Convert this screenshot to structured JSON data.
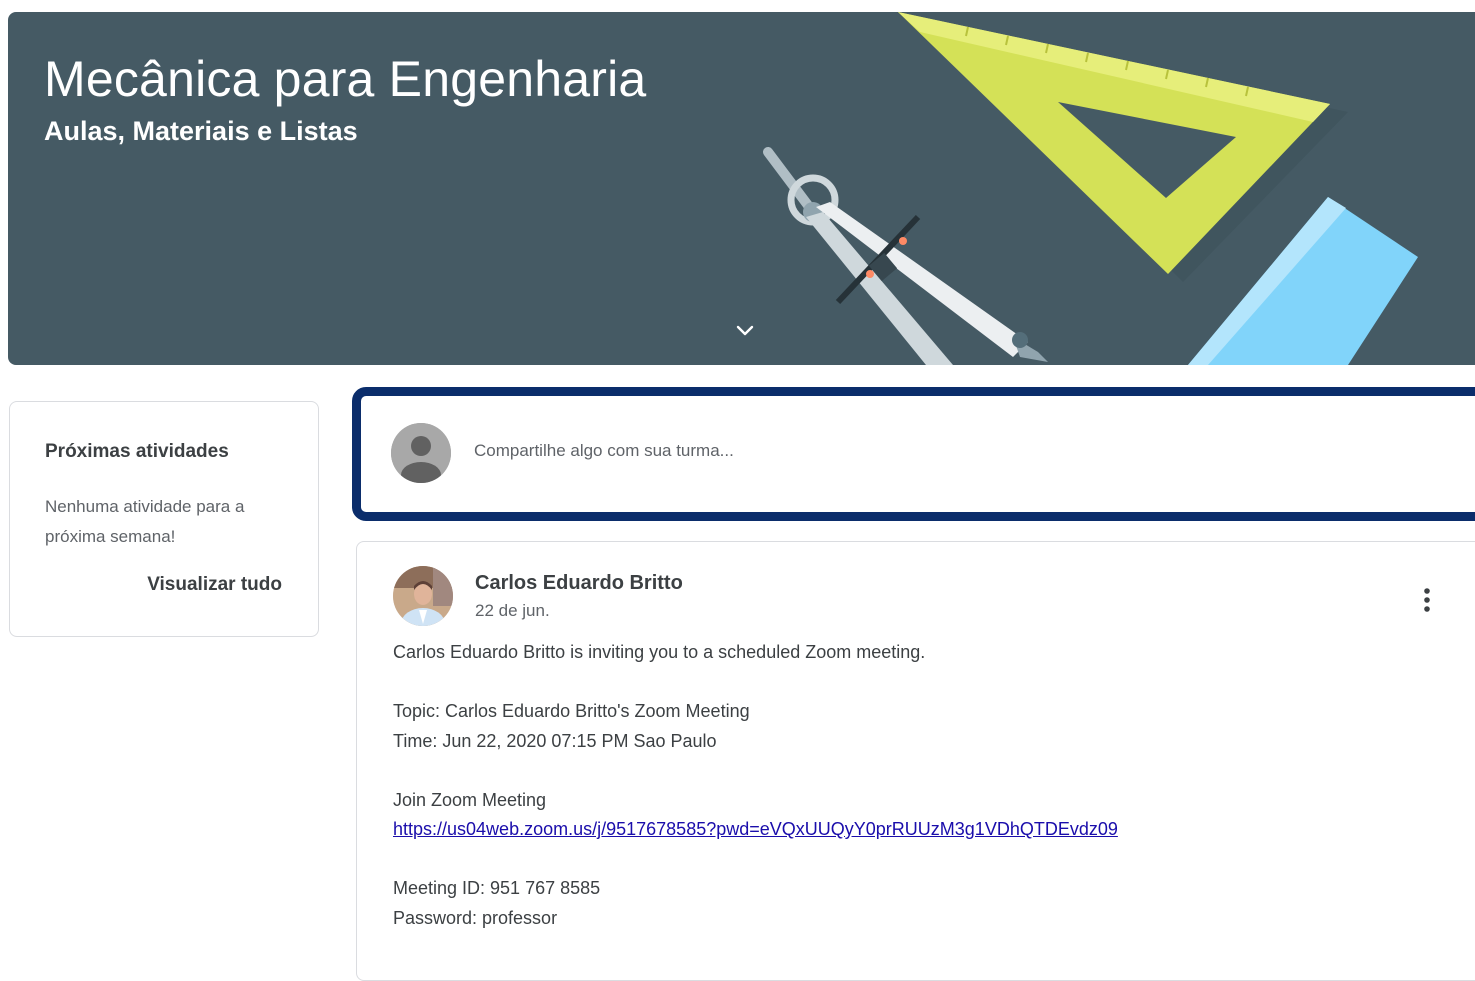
{
  "banner": {
    "title": "Mecânica para Engenharia",
    "subtitle": "Aulas, Materiais e Listas",
    "toggle_icon": "chevron-down-icon",
    "background_color": "#455a64",
    "illustration": "drafting-tools"
  },
  "upcoming": {
    "title": "Próximas atividades",
    "empty_message": "Nenhuma atividade para a próxima semana!",
    "view_all_label": "Visualizar tudo"
  },
  "share": {
    "placeholder": "Compartilhe algo com sua turma...",
    "avatar_icon": "default-user-avatar",
    "highlight_color": "#0b2d6b"
  },
  "post": {
    "author": "Carlos Eduardo Britto",
    "date": "22 de jun.",
    "menu_icon": "more-vertical-icon",
    "lines": {
      "invite": "Carlos Eduardo Britto is inviting you to a scheduled Zoom meeting.",
      "topic": "Topic: Carlos Eduardo Britto's Zoom Meeting",
      "time": "Time: Jun 22, 2020 07:15 PM Sao Paulo",
      "join_label": "Join Zoom Meeting",
      "join_link": "https://us04web.zoom.us/j/9517678585?pwd=eVQxUUQyY0prRUUzM3g1VDhQTDEvdz09",
      "meeting_id": "Meeting ID: 951 767 8585",
      "password": "Password: professor"
    }
  }
}
